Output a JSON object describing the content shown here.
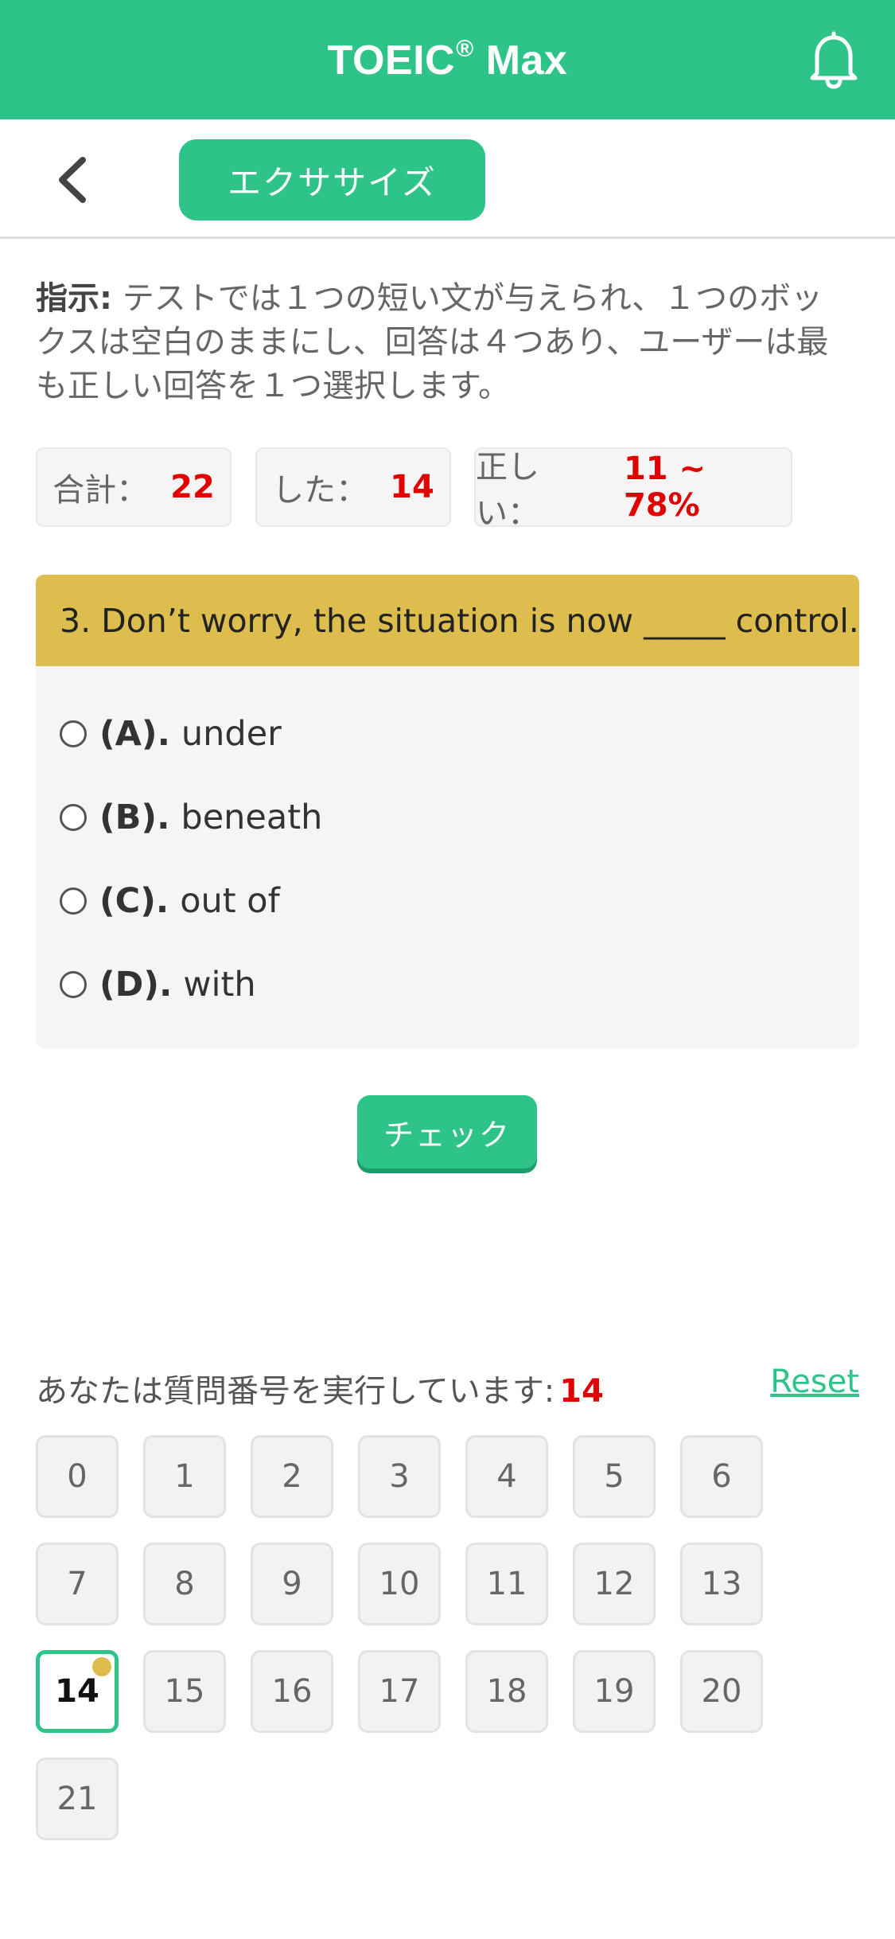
{
  "header": {
    "app_name": "TOEIC",
    "registered_mark": "®",
    "app_suffix": "Max",
    "icons": {
      "notifications": "bell-icon",
      "back": "chevron-left-icon"
    }
  },
  "subheader": {
    "tab_label": "エクササイズ"
  },
  "instructions": {
    "label": "指示:",
    "text": "テストでは１つの短い文が与えられ、１つのボックスは空白のままにし、回答は４つあり、ユーザーは最も正しい回答を１つ選択します。"
  },
  "stats": {
    "total_label": "合計：",
    "total_value": "22",
    "done_label": "した：",
    "done_value": "14",
    "correct_label": "正しい：",
    "correct_value": "11 ~ 78%"
  },
  "question": {
    "text": "3. Don’t worry, the situation is now _____ control.",
    "options": [
      {
        "letter": "(A).",
        "text": "under"
      },
      {
        "letter": "(B).",
        "text": "beneath"
      },
      {
        "letter": "(C).",
        "text": "out of"
      },
      {
        "letter": "(D).",
        "text": "with"
      }
    ]
  },
  "check_button_label": "チェック",
  "progress": {
    "label": "あなたは質問番号を実行しています:",
    "current": "14",
    "reset_label": "Reset"
  },
  "question_numbers": [
    "0",
    "1",
    "2",
    "3",
    "4",
    "5",
    "6",
    "7",
    "8",
    "9",
    "10",
    "11",
    "12",
    "13",
    "14",
    "15",
    "16",
    "17",
    "18",
    "19",
    "20",
    "21"
  ],
  "current_index": 14,
  "colors": {
    "brand_green": "#2ec489",
    "question_header": "#dcbd4e",
    "highlight_red": "#e00000",
    "current_marker": "#dcbd4e"
  }
}
